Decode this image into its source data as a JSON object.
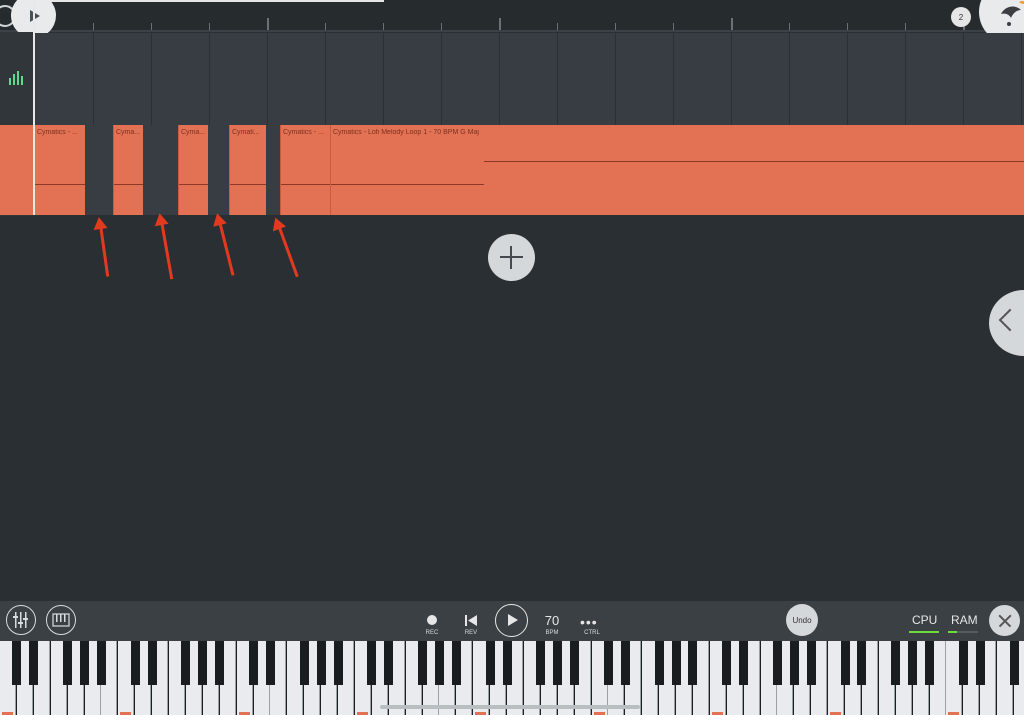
{
  "ruler": {
    "page_indicator": "2"
  },
  "tracks": [
    {
      "name": "automation-track",
      "icon": "level-bars-icon"
    },
    {
      "name": "piano-track",
      "icon": "piano-keys-icon",
      "clips": [
        {
          "title": "Cymatics - ..."
        },
        {
          "title": "Cyma..."
        },
        {
          "title": "Cyma..."
        },
        {
          "title": "Cymati..."
        },
        {
          "title": "Cymatics - ..."
        },
        {
          "title": "Cymatics - Lofi Melody Loop 1 - 70 BPM G Maj"
        }
      ],
      "gap_count": 4
    }
  ],
  "toolbar": {
    "rec_label": "REC",
    "rev_label": "REV",
    "bpm_value": "70",
    "bpm_label": "BPM",
    "ctrl_label": "CTRL",
    "undo_label": "Undo",
    "cpu_label": "CPU",
    "ram_label": "RAM",
    "cpu_level": 1.0,
    "ram_level": 0.3
  },
  "colors": {
    "clip": "#e37154",
    "accent_green": "#6bdc3c",
    "annotation_arrow": "#e33a1f"
  }
}
